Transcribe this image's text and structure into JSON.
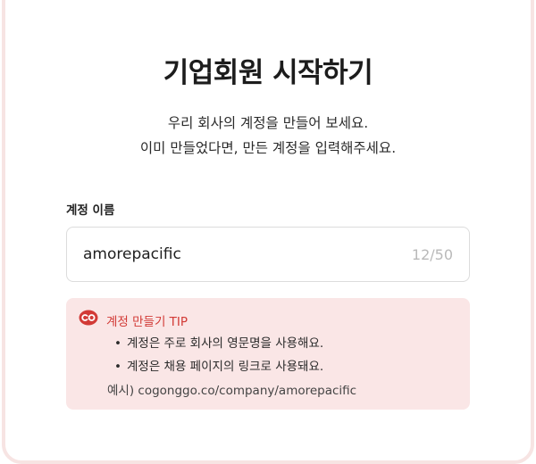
{
  "page": {
    "title": "기업회원 시작하기",
    "subtitle_line1": "우리 회사의 계정을 만들어 보세요.",
    "subtitle_line2": "이미 만들었다면, 만든 계정을 입력해주세요."
  },
  "account_field": {
    "label": "계정 이름",
    "value": "amorepacific",
    "counter": "12/50"
  },
  "tip": {
    "icon": "co-logo-icon",
    "title": "계정 만들기 TIP",
    "items": [
      "계정은 주로 회사의 영문명을 사용해요.",
      "계정은 채용 페이지의 링크로 사용돼요."
    ],
    "example": "예시) cogonggo.co/company/amorepacific"
  },
  "colors": {
    "accent": "#d23a36",
    "tip_background": "#fae6e6",
    "card_border": "#f7e4e3"
  }
}
